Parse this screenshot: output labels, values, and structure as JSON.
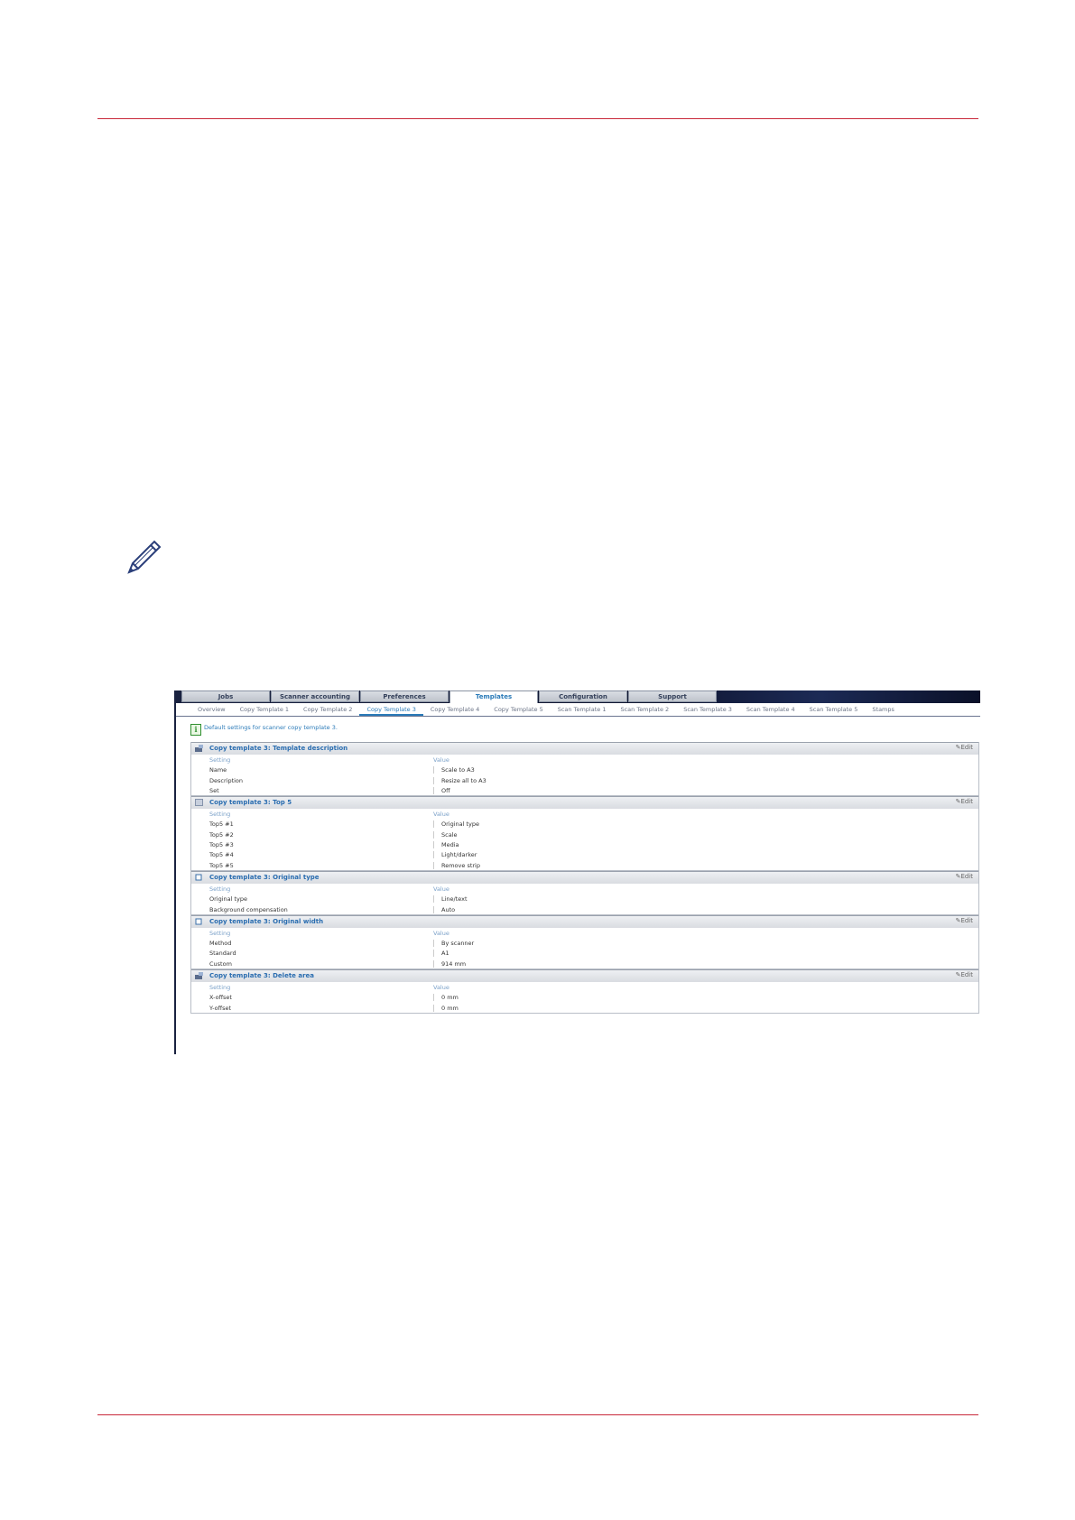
{
  "top_tabs": [
    {
      "label": "Jobs"
    },
    {
      "label": "Scanner accounting"
    },
    {
      "label": "Preferences"
    },
    {
      "label": "Templates"
    },
    {
      "label": "Configuration"
    },
    {
      "label": "Support"
    }
  ],
  "active_top_tab": "Templates",
  "sub_tabs": [
    {
      "label": "Overview"
    },
    {
      "label": "Copy Template 1"
    },
    {
      "label": "Copy Template 2"
    },
    {
      "label": "Copy Template 3"
    },
    {
      "label": "Copy Template 4"
    },
    {
      "label": "Copy Template 5"
    },
    {
      "label": "Scan Template 1"
    },
    {
      "label": "Scan Template 2"
    },
    {
      "label": "Scan Template 3"
    },
    {
      "label": "Scan Template 4"
    },
    {
      "label": "Scan Template 5"
    },
    {
      "label": "Stamps"
    }
  ],
  "active_sub_tab": "Copy Template 3",
  "info_text": "Default settings for scanner copy template 3.",
  "column_headers": {
    "setting": "Setting",
    "value": "Value"
  },
  "edit_label": "Edit",
  "sections": [
    {
      "title": "Copy template 3: Template description",
      "rows": [
        {
          "setting": "Name",
          "value": "Scale to A3"
        },
        {
          "setting": "Description",
          "value": "Resize all to A3"
        },
        {
          "setting": "Set",
          "value": "Off"
        }
      ]
    },
    {
      "title": "Copy template 3: Top 5",
      "rows": [
        {
          "setting": "Top5 #1",
          "value": "Original type"
        },
        {
          "setting": "Top5 #2",
          "value": "Scale"
        },
        {
          "setting": "Top5 #3",
          "value": "Media"
        },
        {
          "setting": "Top5 #4",
          "value": "Light/darker"
        },
        {
          "setting": "Top5 #5",
          "value": "Remove strip"
        }
      ]
    },
    {
      "title": "Copy template 3: Original type",
      "rows": [
        {
          "setting": "Original type",
          "value": "Line/text"
        },
        {
          "setting": "Background compensation",
          "value": "Auto"
        }
      ]
    },
    {
      "title": "Copy template 3: Original width",
      "rows": [
        {
          "setting": "Method",
          "value": "By scanner"
        },
        {
          "setting": "Standard",
          "value": "A1"
        },
        {
          "setting": "Custom",
          "value": "914 mm"
        }
      ]
    },
    {
      "title": "Copy template 3: Delete area",
      "rows": [
        {
          "setting": "X-offset",
          "value": "0 mm"
        },
        {
          "setting": "Y-offset",
          "value": "0 mm"
        }
      ]
    }
  ]
}
